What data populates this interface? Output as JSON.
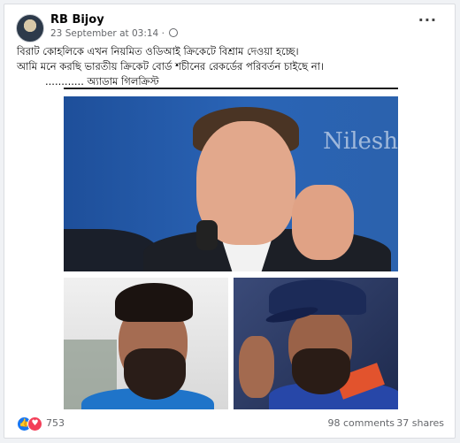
{
  "post": {
    "author": "RB Bijoy",
    "timestamp": "23 September at 03:14",
    "audience_icon": "globe-icon",
    "more_icon": "more-horizontal-icon",
    "text_lines": [
      "বিরাট কোহলিকে এখন নিয়মিত ওডিআই ক্রিকেটে বিশ্রাম দেওয়া হচ্ছে।",
      "আমি মনে করছি ভারতীয় ক্রিকেট বোর্ড শচীনের রেকর্ডের পরিবর্তন চাইছে না।"
    ],
    "signature": "............ অ্যাডাম গিলক্রিস্ট",
    "image_watermark": "Nilesh"
  },
  "footer": {
    "reaction_icons": [
      "like-icon",
      "love-icon"
    ],
    "reaction_count": "753",
    "comments": "98 comments",
    "shares": "37 shares"
  },
  "colors": {
    "like": "#1877f2",
    "love": "#f33e58",
    "meta_text": "#65676b"
  }
}
